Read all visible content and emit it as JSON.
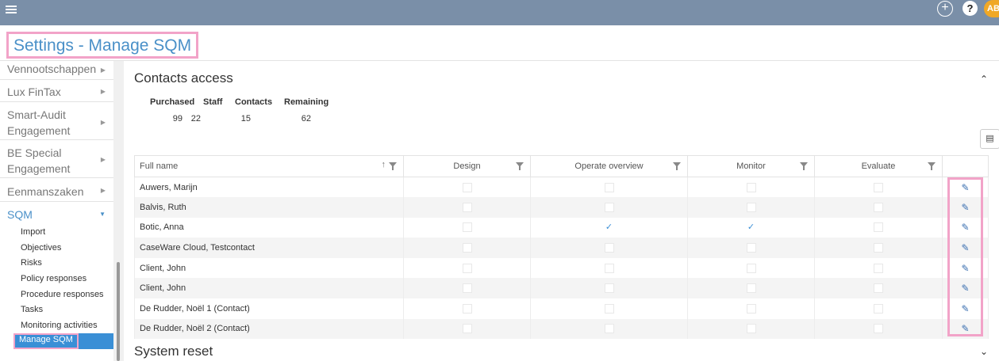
{
  "header": {
    "add_icon": "plus-circle-icon",
    "help_label": "?",
    "avatar_initials": "AB"
  },
  "page": {
    "title": "Settings - Manage SQM"
  },
  "sidebar": {
    "items": [
      {
        "label": "Vennootschappen"
      },
      {
        "label": "Lux FinTax"
      },
      {
        "label": "Smart-Audit Engagement"
      },
      {
        "label": "BE Special Engagement"
      },
      {
        "label": "Eenmanszaken"
      },
      {
        "label": "SQM"
      }
    ],
    "sub_items": [
      {
        "label": "Import"
      },
      {
        "label": "Objectives"
      },
      {
        "label": "Risks"
      },
      {
        "label": "Policy responses"
      },
      {
        "label": "Procedure responses"
      },
      {
        "label": "Tasks"
      },
      {
        "label": "Monitoring activities"
      },
      {
        "label": "Manage SQM"
      }
    ]
  },
  "contacts_access": {
    "title": "Contacts access",
    "summary": {
      "headers": [
        "Purchased",
        "Staff",
        "Contacts",
        "Remaining"
      ],
      "values": [
        "99",
        "22",
        "15",
        "62"
      ]
    },
    "columns": [
      "Full name",
      "Design",
      "Operate overview",
      "Monitor",
      "Evaluate"
    ],
    "rows": [
      {
        "name": "Auwers, Marijn",
        "design": false,
        "operate": false,
        "monitor": false,
        "evaluate": false
      },
      {
        "name": "Balvis, Ruth",
        "design": false,
        "operate": false,
        "monitor": false,
        "evaluate": false
      },
      {
        "name": "Botic, Anna",
        "design": false,
        "operate": true,
        "monitor": true,
        "evaluate": false
      },
      {
        "name": "CaseWare Cloud, Testcontact",
        "design": false,
        "operate": false,
        "monitor": false,
        "evaluate": false
      },
      {
        "name": "Client, John",
        "design": false,
        "operate": false,
        "monitor": false,
        "evaluate": false
      },
      {
        "name": "Client, John",
        "design": false,
        "operate": false,
        "monitor": false,
        "evaluate": false
      },
      {
        "name": "De Rudder, Noël 1 (Contact)",
        "design": false,
        "operate": false,
        "monitor": false,
        "evaluate": false
      },
      {
        "name": "De Rudder, Noël 2 (Contact)",
        "design": false,
        "operate": false,
        "monitor": false,
        "evaluate": false
      }
    ]
  },
  "system_reset": {
    "title": "System reset"
  },
  "colors": {
    "topbar": "#7a8fa8",
    "accent": "#3a8fd6",
    "highlight": "#f2a3c8",
    "avatar": "#f0a826"
  }
}
